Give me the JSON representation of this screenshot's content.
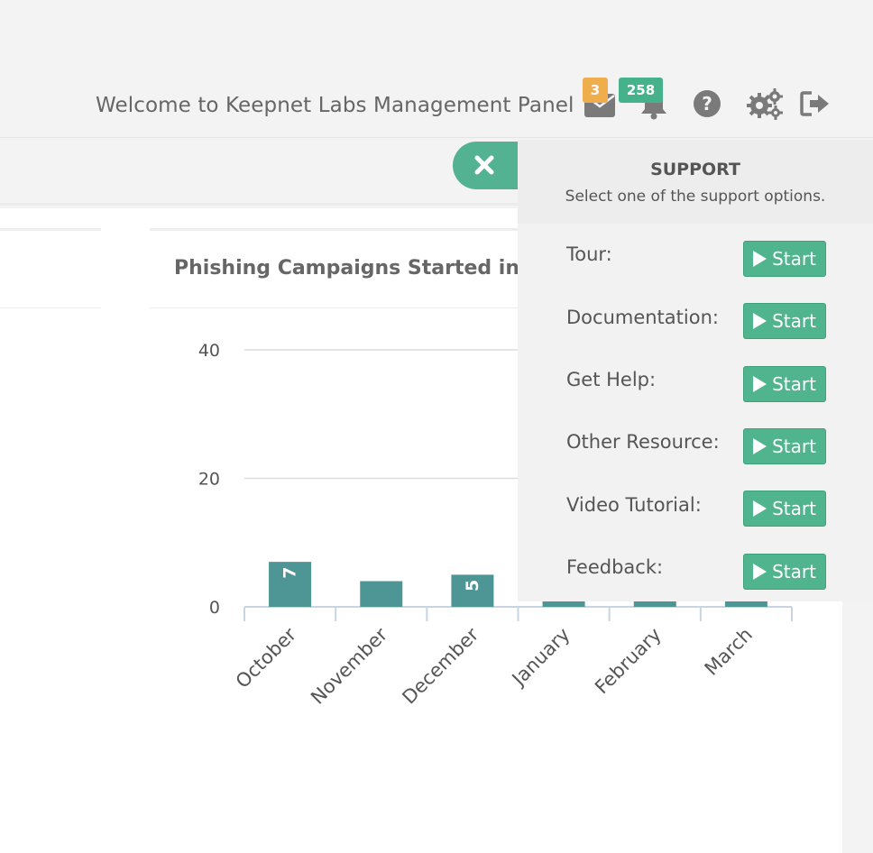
{
  "header": {
    "welcome": "Welcome to Keepnet Labs Management Panel",
    "mail_badge": "3",
    "notification_badge": "258",
    "colors": {
      "orange_badge": "#f0ad4e",
      "green_badge": "#46b28c",
      "icon": "#777777"
    },
    "icons": [
      "mail-icon",
      "bell-icon",
      "help-icon",
      "settings-icon",
      "logout-icon"
    ]
  },
  "chart_title": "Phishing Campaigns Started in t",
  "chart_data": {
    "type": "bar",
    "categories": [
      "October",
      "November",
      "December",
      "January",
      "February",
      "March"
    ],
    "values": [
      7,
      4,
      5,
      1,
      1,
      1
    ],
    "data_labels": [
      "7",
      "",
      "5",
      "",
      "",
      ""
    ],
    "y_ticks": [
      "0",
      "20",
      "40"
    ],
    "ylim": [
      0,
      40
    ],
    "bar_color": "#4e9696",
    "grid": true
  },
  "support": {
    "title": "SUPPORT",
    "subtitle": "Select one of the support options.",
    "items": [
      {
        "label": "Tour:",
        "button": "Start"
      },
      {
        "label": "Documentation:",
        "button": "Start"
      },
      {
        "label": "Get Help:",
        "button": "Start"
      },
      {
        "label": "Other Resource:",
        "button": "Start"
      },
      {
        "label": "Video Tutorial:",
        "button": "Start"
      },
      {
        "label": "Feedback:",
        "button": "Start"
      }
    ],
    "accent": "#50b48e"
  }
}
